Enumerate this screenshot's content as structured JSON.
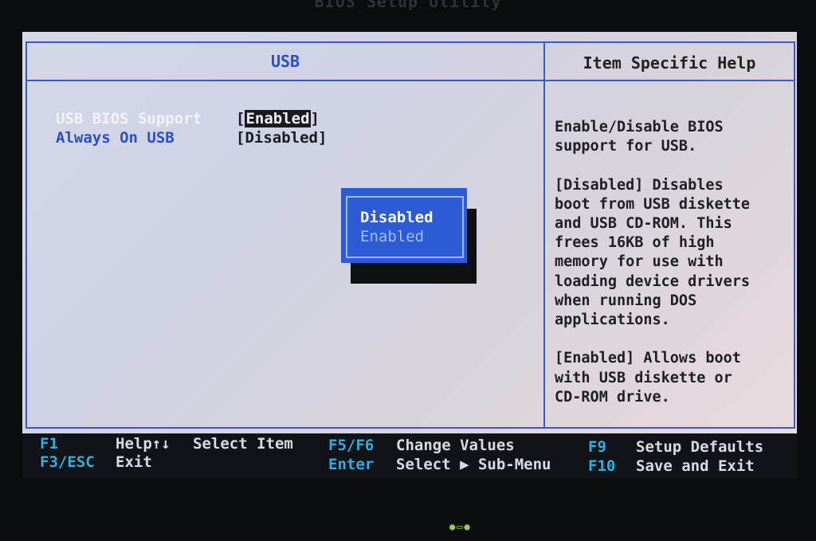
{
  "window_title": "BIOS Setup Utility",
  "left_panel": {
    "title": "USB",
    "items": [
      {
        "label": "USB BIOS Support",
        "value": "Enabled",
        "selected": true
      },
      {
        "label": "Always On USB",
        "value": "Disabled",
        "selected": false
      }
    ]
  },
  "help_panel": {
    "title": "Item Specific Help",
    "text": "Enable/Disable BIOS\nsupport for USB.\n\n[Disabled] Disables\nboot from USB diskette\nand USB CD-ROM. This\nfrees 16KB of high\nmemory for use with\nloading device drivers\nwhen running DOS\napplications.\n\n[Enabled] Allows boot\nwith USB diskette or\nCD-ROM drive."
  },
  "popup": {
    "options": [
      "Disabled",
      "Enabled"
    ],
    "highlighted": "Disabled"
  },
  "footer": {
    "keys": [
      {
        "key": "F1",
        "desc": "Help↑↓"
      },
      {
        "key": "",
        "desc": "Select Item"
      },
      {
        "key": "F5/F6",
        "desc": "Change Values"
      },
      {
        "key": "F9",
        "desc": "Setup Defaults"
      },
      {
        "key": "F3/ESC",
        "desc": "Exit"
      },
      {
        "key": "",
        "desc": ""
      },
      {
        "key": "Enter",
        "desc": "Select ▶ Sub-Menu"
      },
      {
        "key": "F10",
        "desc": "Save and Exit"
      }
    ]
  },
  "colors": {
    "frame": "#3d5bbf",
    "accent_blue": "#2a4fc8",
    "popup_bg": "#2d5bd6",
    "key_cyan": "#2bb0e0"
  }
}
